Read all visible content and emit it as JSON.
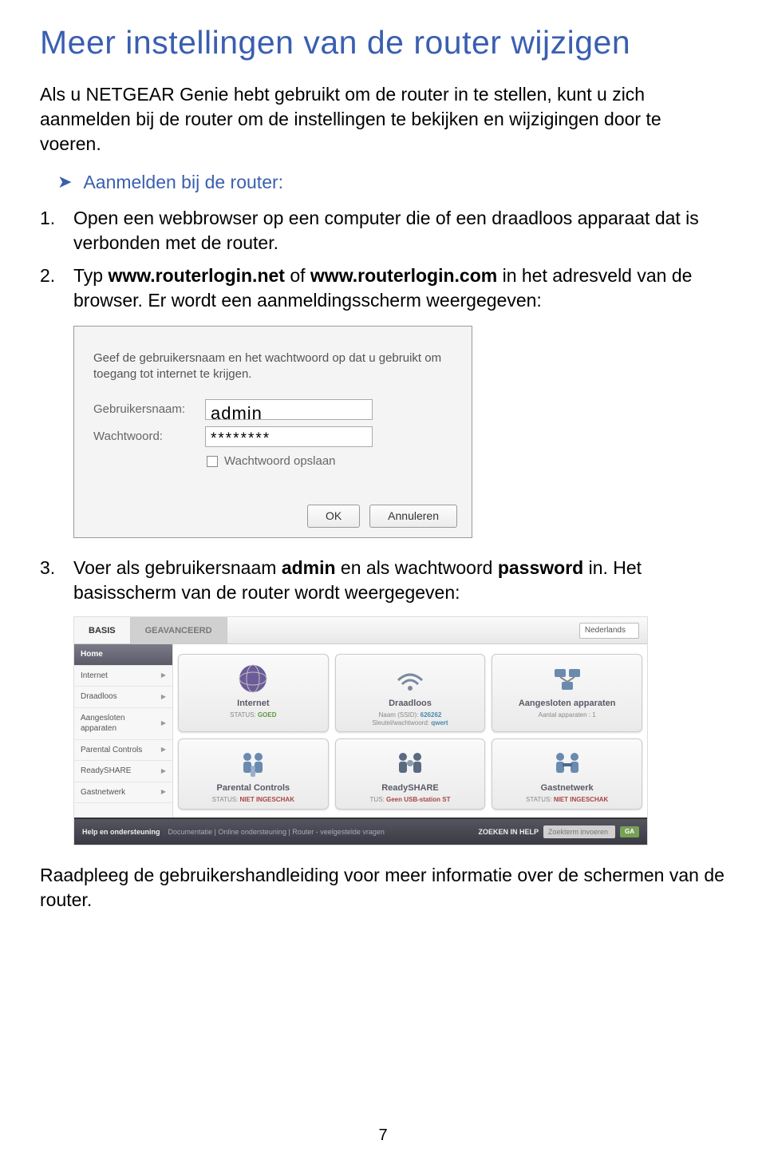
{
  "title": "Meer instellingen van de router wijzigen",
  "intro": "Als u NETGEAR Genie hebt gebruikt om de router in te stellen, kunt u zich aanmelden bij de router om de instellingen te bekijken en wijzigingen door te voeren.",
  "sub_head": "Aanmelden bij de router:",
  "steps": {
    "s1": "Open een webbrowser op een computer die of een draadloos apparaat dat is verbonden met de router.",
    "s2a": "Typ ",
    "s2b": "www.routerlogin.net",
    "s2c": " of ",
    "s2d": "www.routerlogin.com",
    "s2e": " in het adresveld van de browser. Er wordt een aanmeldingsscherm weergegeven:",
    "s3a": "Voer als gebruikersnaam ",
    "s3b": "admin",
    "s3c": " en als wachtwoord ",
    "s3d": "password",
    "s3e": " in. Het basisscherm van de router wordt weergegeven:"
  },
  "dialog": {
    "instr": "Geef de gebruikersnaam en het wachtwoord op dat u gebruikt om toegang tot internet te krijgen.",
    "user_label": "Gebruikersnaam:",
    "user_value": "admin",
    "pw_label": "Wachtwoord:",
    "pw_value": "********",
    "save_pw": "Wachtwoord opslaan",
    "ok": "OK",
    "cancel": "Annuleren"
  },
  "dash": {
    "tab_basic": "BASIS",
    "tab_adv": "GEAVANCEERD",
    "lang": "Nederlands",
    "sidebar": [
      "Home",
      "Internet",
      "Draadloos",
      "Aangesloten apparaten",
      "Parental Controls",
      "ReadySHARE",
      "Gastnetwerk"
    ],
    "tiles": [
      {
        "title": "Internet",
        "line1": "STATUS:",
        "val1": "GOED",
        "cls": "g"
      },
      {
        "title": "Draadloos",
        "line1": "Naam (SSID):",
        "val1": "626262",
        "line2": "Sleutel/wachtwoord:",
        "val2": "qwert",
        "cls": "b"
      },
      {
        "title": "Aangesloten apparaten",
        "line1": "Aantal apparaten :",
        "val1": "1",
        "cls": ""
      },
      {
        "title": "Parental Controls",
        "line1": "STATUS:",
        "val1": "NIET INGESCHAK",
        "cls": "r"
      },
      {
        "title": "ReadySHARE",
        "line1": "TUS:",
        "val1": "Geen USB-station ST",
        "cls": "r"
      },
      {
        "title": "Gastnetwerk",
        "line1": "STATUS:",
        "val1": "NIET INGESCHAK",
        "cls": "r"
      }
    ],
    "footer": {
      "help": "Help en ondersteuning",
      "links": "Documentatie | Online ondersteuning | Router - veelgestelde vragen",
      "search_label": "ZOEKEN IN HELP",
      "search_ph": "Zoekterm invoeren",
      "go": "GA"
    }
  },
  "outro": "Raadpleeg de gebruikershandleiding voor meer informatie over de schermen van de router.",
  "pagenum": "7"
}
